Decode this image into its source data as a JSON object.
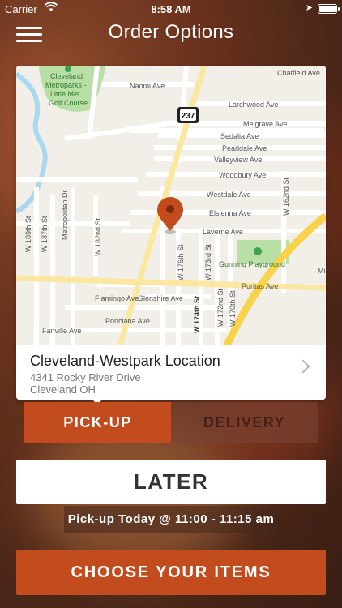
{
  "status_bar": {
    "carrier": "Carrier",
    "time": "8:58 AM"
  },
  "header": {
    "title": "Order Options",
    "menu_icon": "hamburger-menu-icon"
  },
  "map": {
    "highway_shield": "237",
    "labels": {
      "naomi": "Naomi Ave",
      "chatfield": "Chatfield Ave",
      "cleveland1": "Cleveland",
      "cleveland2": "Metroparks -",
      "cleveland3": "Little Met",
      "cleveland4": "Golf Course",
      "larchwood": "Larchwood Ave",
      "melgrave": "Melgrave Ave",
      "sedalia": "Sedalia Ave",
      "pearldale": "Pearldale Ave",
      "valleyview": "Valleyview Ave",
      "woodbury": "Woodbury Ave",
      "westdale": "Westdale Ave",
      "elsienna": "Elsienna Ave",
      "laverne": "Laverne Ave",
      "gunning": "Gunning Playground",
      "puritas": "Puritas Ave",
      "flamingo": "Flamingo Ave",
      "glenshire": "Glenshire Ave",
      "poinciana": "Ponciana Ave",
      "fairville": "Fairville Ave",
      "w189": "W 189th St",
      "w187": "W 187th St",
      "metropolitan": "Metropolitan Dr",
      "w182": "W 182nd St",
      "w176": "W 176th St",
      "w174": "W 174th St",
      "w173": "W 173rd St",
      "w172": "W 172nd St",
      "w170": "W 170th St",
      "w162": "W 162nd St",
      "mi": "Mi"
    },
    "colors": {
      "park": "#b9dfa6",
      "water": "#a9d8f0",
      "major_road": "#f7d34a"
    }
  },
  "location": {
    "name": "Cleveland-Westpark Location",
    "address_line1": "4341 Rocky River Drive",
    "address_line2": "Cleveland OH"
  },
  "order_type": {
    "pickup_label": "PICK-UP",
    "delivery_label": "DELIVERY",
    "selected": "PICK-UP"
  },
  "timing": {
    "later_label": "LATER",
    "pickup_time_text": "Pick-up Today @ 11:00 - 11:15 am"
  },
  "cta": {
    "choose_items_label": "CHOOSE YOUR ITEMS"
  },
  "colors": {
    "accent": "#c24c1d"
  }
}
